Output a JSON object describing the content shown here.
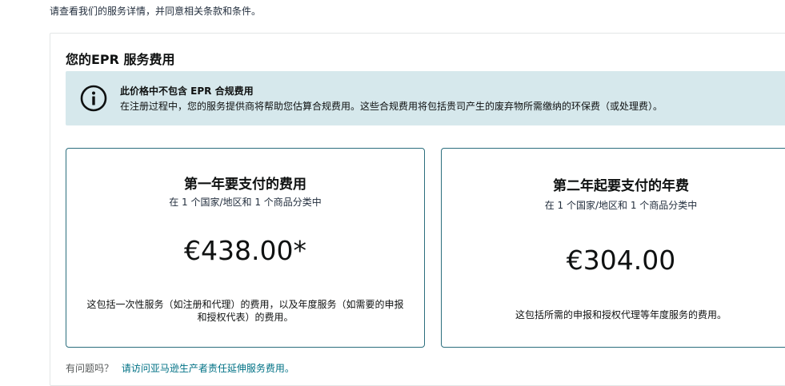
{
  "top_note": "请查看我们的服务详情，并同意相关条款和条件。",
  "section": {
    "title": "您的EPR 服务费用"
  },
  "info": {
    "icon": "info-icon",
    "title": "此价格中不包含 EPR 合规费用",
    "text": "在注册过程中，您的服务提供商将帮助您估算合规费用。这些合规费用将包括贵司产生的废弃物所需缴纳的环保费（或处理费）。"
  },
  "cards": [
    {
      "title": "第一年要支付的费用",
      "subtitle": "在 1 个国家/地区和 1 个商品分类中",
      "price": "€438.00*",
      "description": "这包括一次性服务（如注册和代理）的费用，以及年度服务（如需要的申报和授权代表）的费用。"
    },
    {
      "title": "第二年起要支付的年费",
      "subtitle": "在 1 个国家/地区和 1 个商品分类中",
      "price": "€304.00",
      "description": "这包括所需的申报和授权代理等年度服务的费用。"
    }
  ],
  "footer": {
    "question": "有问题吗？",
    "link": "请访问亚马逊生产者责任延伸服务费用。"
  },
  "colors": {
    "info_bg": "#d6e8ec",
    "card_border": "#2b6e7d",
    "link": "#007185"
  }
}
